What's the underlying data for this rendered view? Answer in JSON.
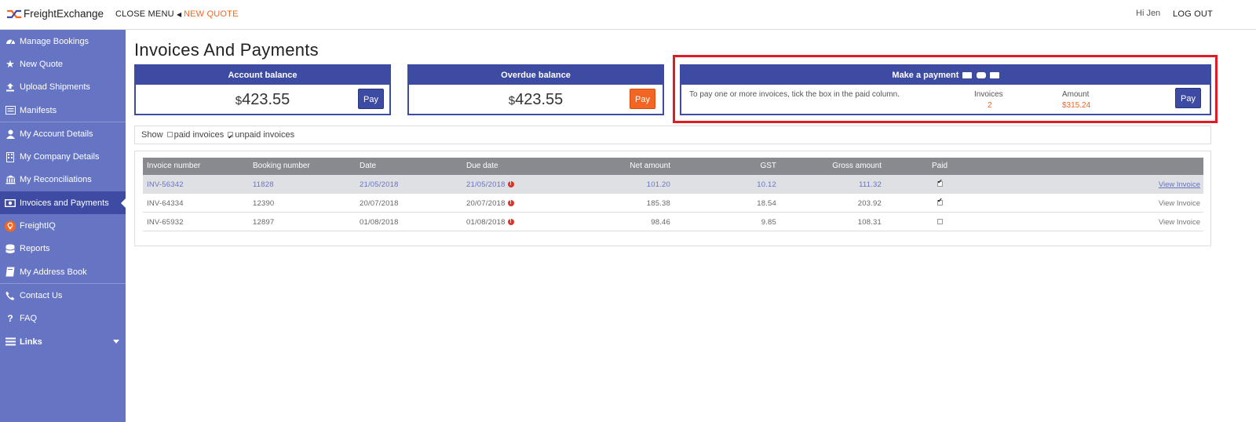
{
  "topbar": {
    "brand": "FreightExchange",
    "close_menu": "CLOSE MENU",
    "new_quote": "NEW QUOTE",
    "greeting": "Hi Jen",
    "logout": "LOG OUT"
  },
  "sidebar": {
    "items": [
      {
        "label": "Manage Bookings",
        "icon": "dashboard-icon"
      },
      {
        "label": "New Quote",
        "icon": "star-icon"
      },
      {
        "label": "Upload Shipments",
        "icon": "upload-icon"
      },
      {
        "label": "Manifests",
        "icon": "list-icon"
      },
      {
        "label": "My Account Details",
        "icon": "user-icon"
      },
      {
        "label": "My Company Details",
        "icon": "building-icon"
      },
      {
        "label": "My Reconciliations",
        "icon": "bank-icon"
      },
      {
        "label": "Invoices and Payments",
        "icon": "money-icon"
      },
      {
        "label": "FreightIQ",
        "icon": "lightbulb-icon"
      },
      {
        "label": "Reports",
        "icon": "database-icon"
      },
      {
        "label": "My Address Book",
        "icon": "book-icon"
      },
      {
        "label": "Contact Us",
        "icon": "phone-icon"
      },
      {
        "label": "FAQ",
        "icon": "question-icon"
      },
      {
        "label": "Links",
        "icon": "menu-icon"
      }
    ]
  },
  "page": {
    "title": "Invoices And Payments"
  },
  "account_balance": {
    "title": "Account balance",
    "currency": "$",
    "amount": "423.55",
    "pay_label": "Pay"
  },
  "overdue_balance": {
    "title": "Overdue balance",
    "currency": "$",
    "amount": "423.55",
    "pay_label": "Pay"
  },
  "make_payment": {
    "title": "Make a payment",
    "instruction": "To pay one or more invoices, tick the box in the paid column.",
    "invoices_label": "Invoices",
    "invoices_value": "2",
    "amount_label": "Amount",
    "amount_value": "$315.24",
    "pay_label": "Pay"
  },
  "filter": {
    "show": "Show",
    "paid": "paid invoices",
    "unpaid": "unpaid invoices"
  },
  "table": {
    "headers": [
      "Invoice number",
      "Booking number",
      "Date",
      "Due date",
      "Net amount",
      "GST",
      "Gross amount",
      "Paid"
    ],
    "rows": [
      {
        "invoice": "INV-56342",
        "booking": "11828",
        "date": "21/05/2018",
        "due": "21/05/2018",
        "net": "101.20",
        "gst": "10.12",
        "gross": "111.32",
        "paid": true,
        "view": "View Invoice"
      },
      {
        "invoice": "INV-64334",
        "booking": "12390",
        "date": "20/07/2018",
        "due": "20/07/2018",
        "net": "185.38",
        "gst": "18.54",
        "gross": "203.92",
        "paid": true,
        "view": "View Invoice"
      },
      {
        "invoice": "INV-65932",
        "booking": "12897",
        "date": "01/08/2018",
        "due": "01/08/2018",
        "net": "98.46",
        "gst": "9.85",
        "gross": "108.31",
        "paid": false,
        "view": "View Invoice"
      }
    ]
  },
  "colors": {
    "primary": "#3e4ba2",
    "sidebar": "#6674c4",
    "accent": "#f26522",
    "highlight": "#e01b24"
  }
}
